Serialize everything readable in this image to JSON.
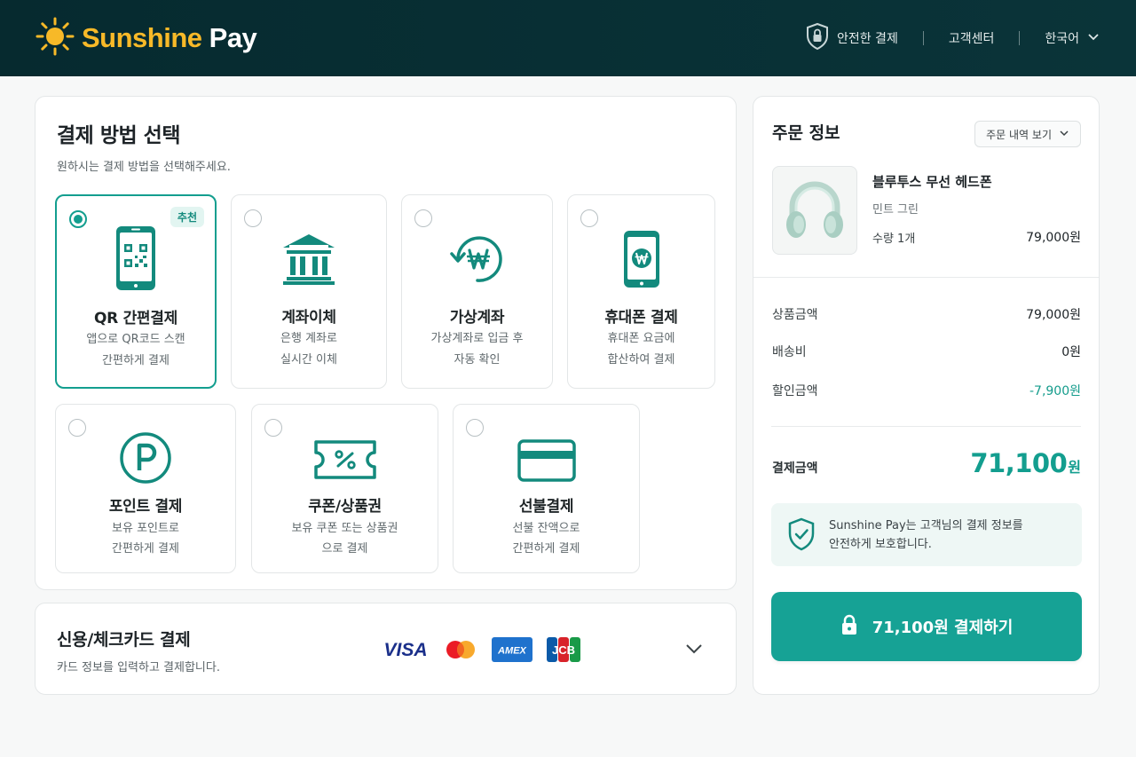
{
  "header": {
    "brand_part1": "Sunshine",
    "brand_part2": "Pay",
    "secure_payment": "안전한 결제",
    "customer_center": "고객센터",
    "language": "한국어",
    "icons": [
      "sun-icon",
      "shield-lock-icon",
      "chevron-down-icon"
    ]
  },
  "payment": {
    "title": "결제 방법 선택",
    "subtitle": "원하시는 결제 방법을 선택해주세요.",
    "methods": [
      {
        "title": "QR 간편결제",
        "desc1": "앱으로 QR코드 스캔",
        "desc2": "간편하게 결제",
        "badge": "추천",
        "selected": true,
        "icon": "qr-phone-icon"
      },
      {
        "title": "계좌이체",
        "desc1": "은행 계좌로",
        "desc2": "실시간 이체",
        "selected": false,
        "icon": "bank-icon"
      },
      {
        "title": "가상계좌",
        "desc1": "가상계좌로 입금 후",
        "desc2": "자동 확인",
        "selected": false,
        "icon": "won-refresh-icon"
      },
      {
        "title": "휴대폰 결제",
        "desc1": "휴대폰 요금에",
        "desc2": "합산하여 결제",
        "selected": false,
        "icon": "mobile-won-icon"
      },
      {
        "title": "포인트 결제",
        "desc1": "보유 포인트로",
        "desc2": "간편하게 결제",
        "selected": false,
        "icon": "point-icon"
      },
      {
        "title": "쿠폰/상품권",
        "desc1": "보유 쿠폰 또는 상품권",
        "desc2": "으로 결제",
        "selected": false,
        "icon": "coupon-icon"
      },
      {
        "title": "선불결제",
        "desc1": "선불 잔액으로",
        "desc2": "간편하게 결제",
        "selected": false,
        "icon": "prepaid-card-icon"
      }
    ]
  },
  "credit": {
    "title": "신용/체크카드 결제",
    "subtitle": "카드 정보를 입력하고 결제합니다.",
    "brands": {
      "visa": "VISA",
      "amex": "AMEX",
      "jcb": "JCB"
    }
  },
  "order": {
    "title": "주문 정보",
    "detail_button": "주문 내역 보기",
    "product": {
      "name": "블루투스 무선 헤드폰",
      "option": "민트 그린",
      "quantity": "수량 1개",
      "price": "79,000원"
    },
    "summary": [
      {
        "label": "상품금액",
        "value": "79,000원"
      },
      {
        "label": "배송비",
        "value": "0원"
      },
      {
        "label": "할인금액",
        "value": "-7,900원"
      }
    ],
    "total_label": "결제금액",
    "total_amount": "71,100",
    "total_unit": "원",
    "secure_line1": "Sunshine Pay는 고객님의 결제 정보를",
    "secure_line2": "안전하게 보호합니다.",
    "pay_button": "71,100원 결제하기"
  },
  "colors": {
    "accent": "#139e8f",
    "brand_sun": "#f7b928",
    "header_bg": "#062a2f"
  }
}
